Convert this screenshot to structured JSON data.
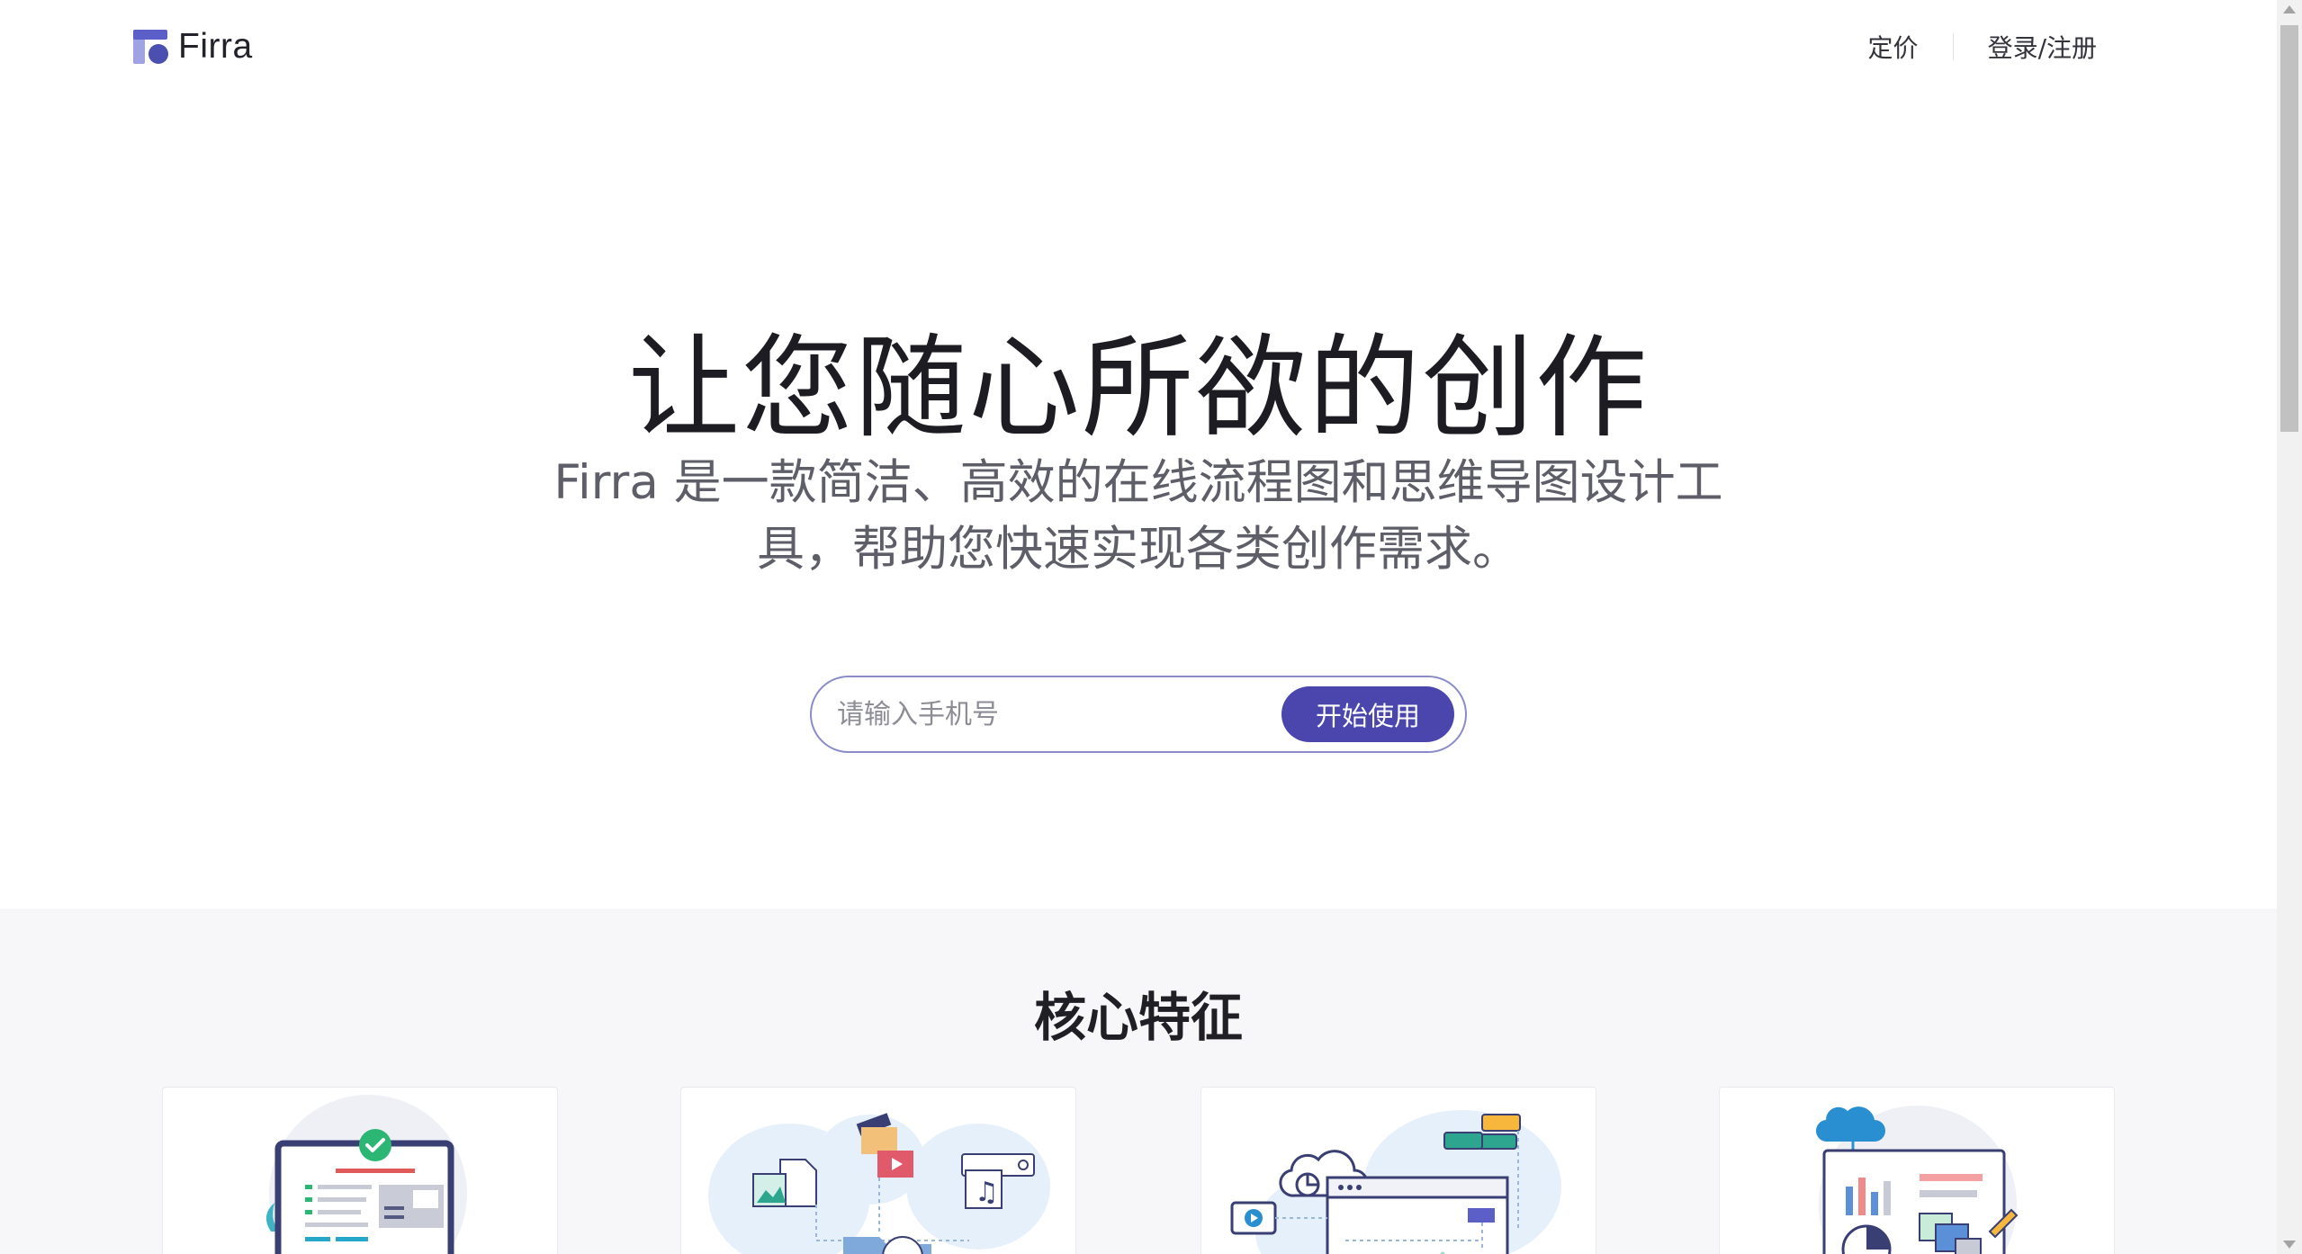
{
  "header": {
    "logo_text": "Firra",
    "nav": {
      "pricing": "定价",
      "login": "登录/注册"
    }
  },
  "hero": {
    "title": "让您随心所欲的创作",
    "subtitle_line1": "Firra 是一款简洁、高效的在线流程图和思维导图设计工",
    "subtitle_line2": "具，帮助您快速实现各类创作需求。",
    "phone_placeholder": "请输入手机号",
    "cta_label": "开始使用"
  },
  "features": {
    "title": "核心特征",
    "cards": [
      {
        "icon": "device-checklist-illustration"
      },
      {
        "icon": "media-files-illustration"
      },
      {
        "icon": "cloud-flowchart-illustration"
      },
      {
        "icon": "cloud-analytics-illustration"
      }
    ]
  },
  "colors": {
    "brand": "#4a46ad",
    "text": "#1c1c22",
    "muted": "#5d5e68",
    "section_bg": "#f7f7f9"
  }
}
